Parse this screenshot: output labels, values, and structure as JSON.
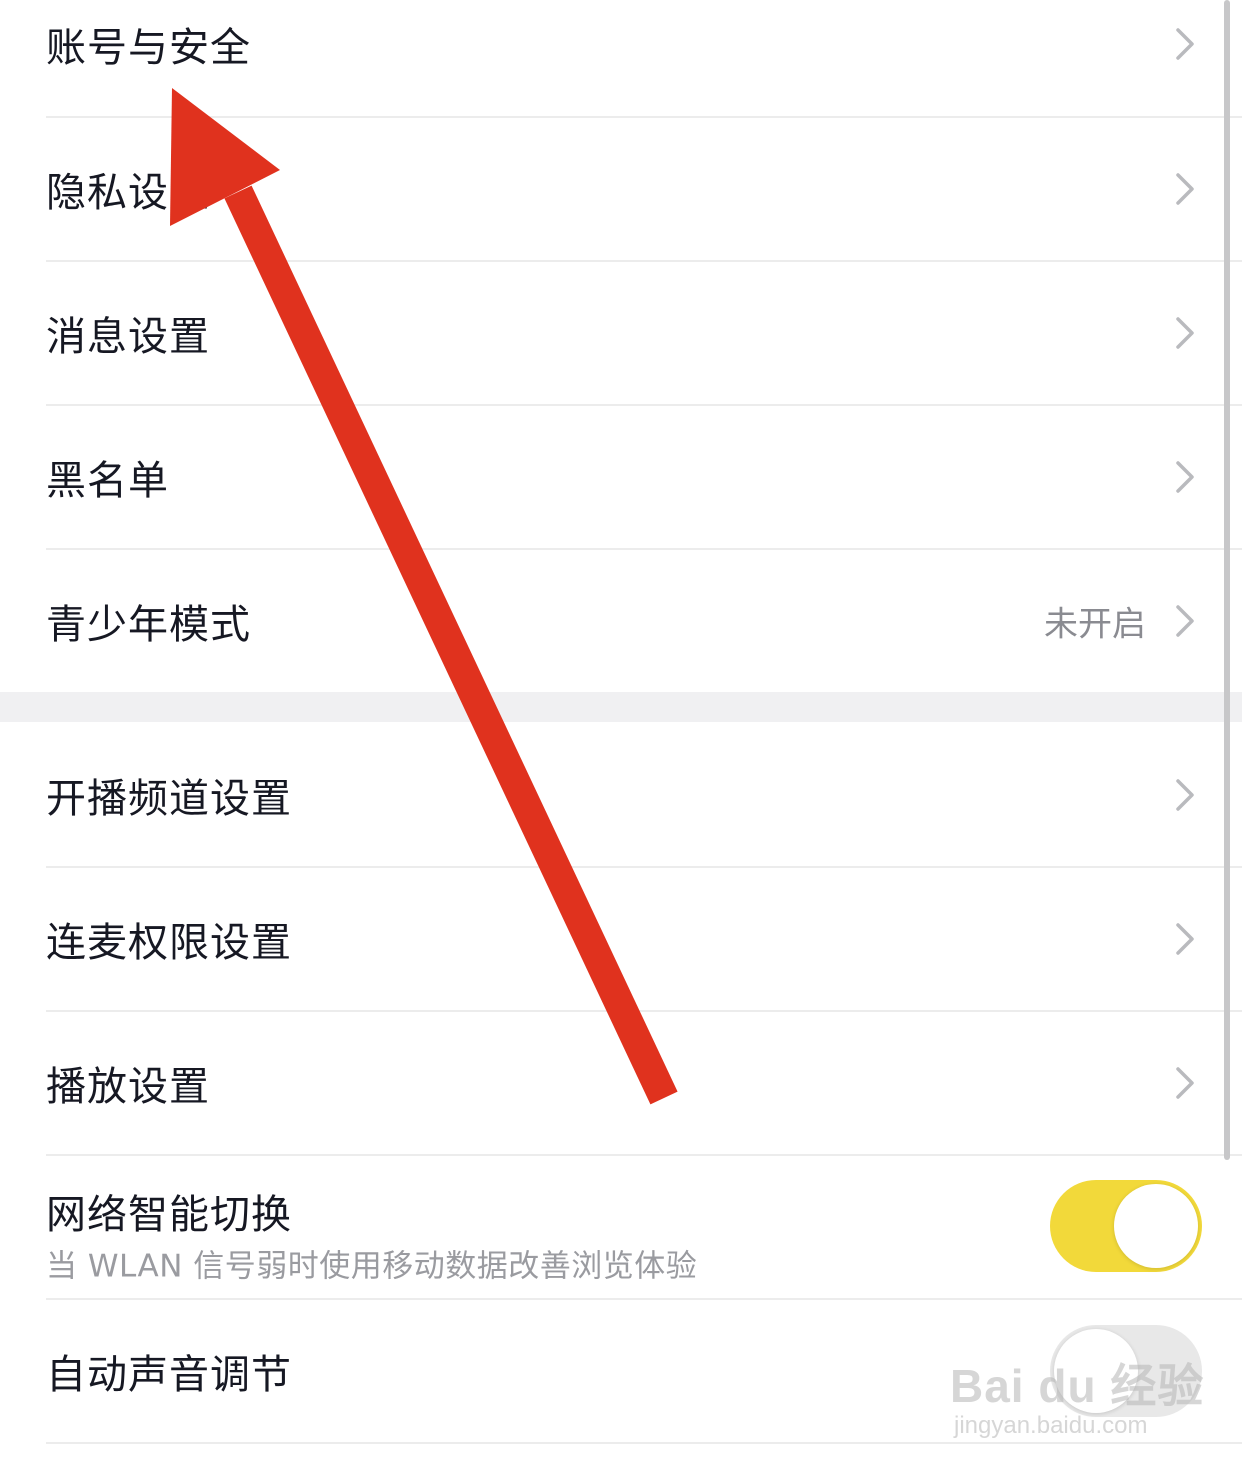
{
  "settings": {
    "items": [
      {
        "label": "账号与安全",
        "value": ""
      },
      {
        "label": "隐私设置",
        "value": ""
      },
      {
        "label": "消息设置",
        "value": ""
      },
      {
        "label": "黑名单",
        "value": ""
      },
      {
        "label": "青少年模式",
        "value": "未开启"
      }
    ],
    "items2": [
      {
        "label": "开播频道设置"
      },
      {
        "label": "连麦权限设置"
      },
      {
        "label": "播放设置"
      }
    ],
    "network": {
      "label": "网络智能切换",
      "description": "当 WLAN 信号弱时使用移动数据改善浏览体验",
      "enabled": true
    },
    "auto_volume": {
      "label": "自动声音调节",
      "enabled": false
    }
  },
  "watermark": {
    "brand": "Bai du 经验",
    "url": "jingyan.baidu.com"
  },
  "colors": {
    "toggle_on": "#f2d93a",
    "arrow": "#e0321e",
    "text_primary": "#161823",
    "text_secondary": "#8a8b91"
  },
  "icons": {
    "row_chevron": "chevron-right-icon",
    "annotation": "red-arrow-annotation"
  }
}
